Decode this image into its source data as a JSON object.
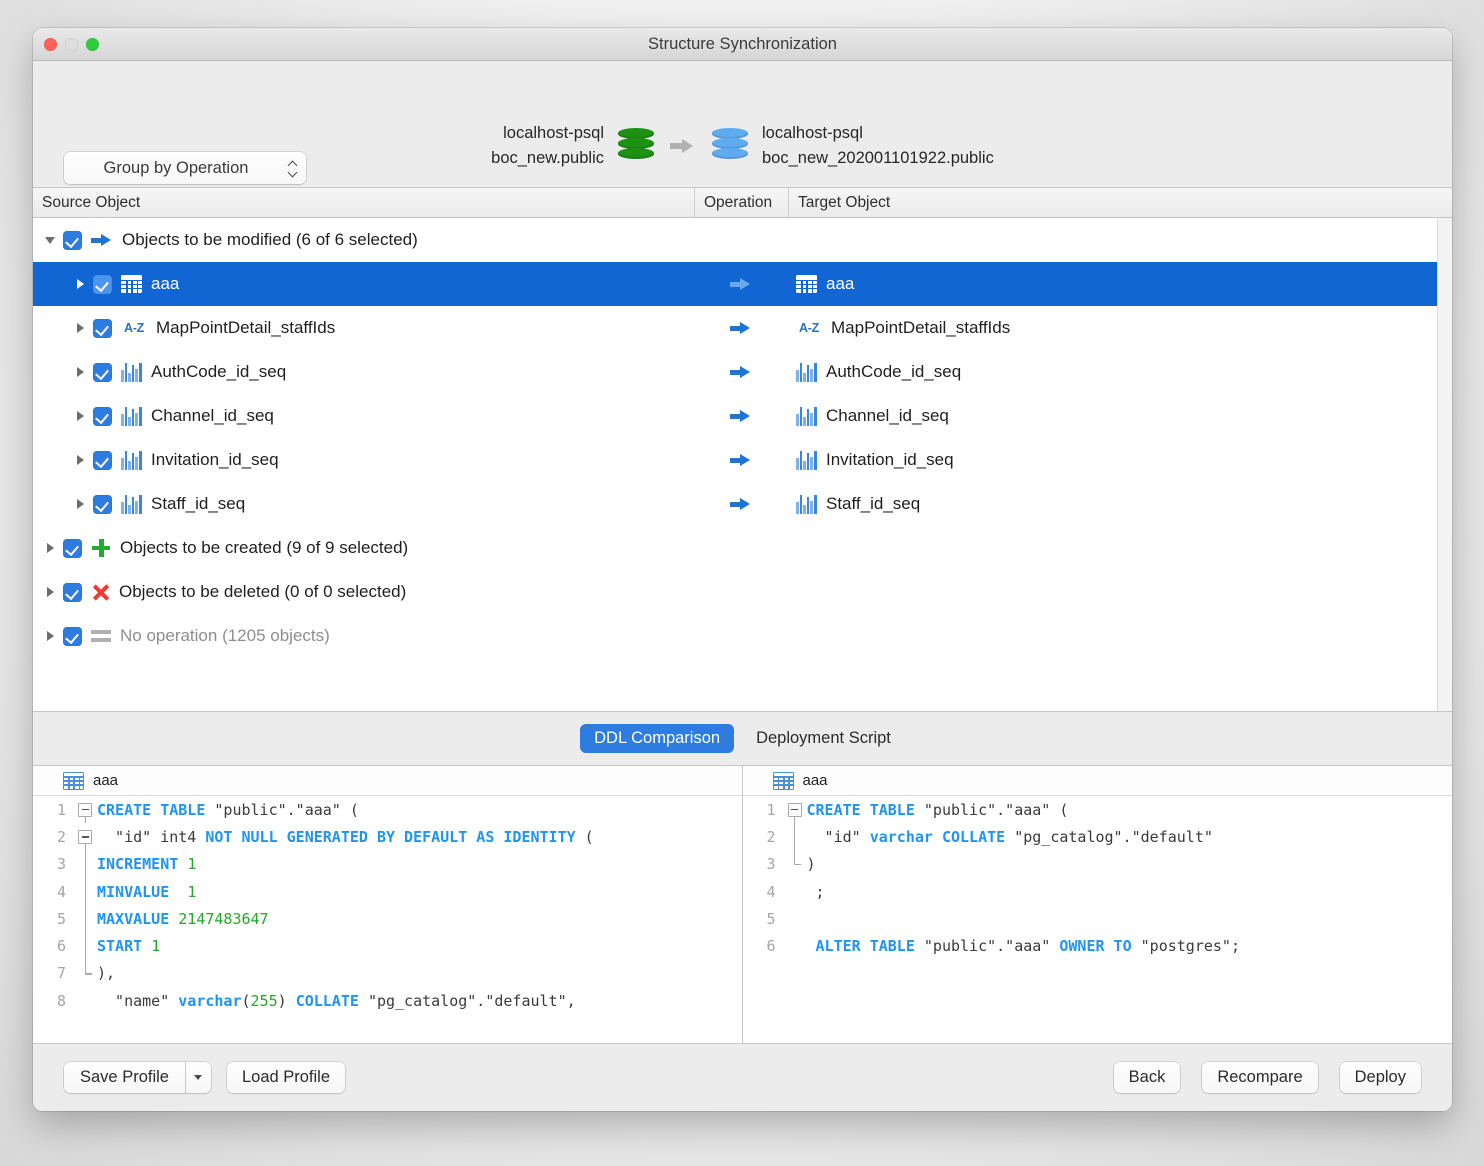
{
  "window": {
    "title": "Structure Synchronization",
    "traffic_lights": [
      "close-red",
      "minimize-gray",
      "maximize-green"
    ]
  },
  "toolbar": {
    "group_select_label": "Group by Operation",
    "source_db": {
      "connection": "localhost-psql",
      "schema": "boc_new.public",
      "icon": "database-icon-green",
      "color": "#1c9113"
    },
    "target_db": {
      "connection": "localhost-psql",
      "schema": "boc_new_202001101922.public",
      "icon": "database-icon-blue",
      "color": "#5fabf2"
    },
    "direction_icon": "right-arrow-icon"
  },
  "columns": {
    "source": "Source Object",
    "operation": "Operation",
    "target": "Target Object"
  },
  "tree": [
    {
      "label": "Objects to be modified (6 of 6 selected)",
      "level": 0,
      "expanded": true,
      "checked": true,
      "glyph": "arrow-right-blue-icon",
      "muted": false,
      "operation": "",
      "target": "",
      "target_icon": ""
    },
    {
      "label": "aaa",
      "level": 1,
      "expanded": false,
      "checked": true,
      "icon": "table-icon",
      "selected": true,
      "operation": "arrow-right-blue-icon",
      "target": "aaa",
      "target_icon": "table-icon"
    },
    {
      "label": "MapPointDetail_staffIds",
      "level": 1,
      "expanded": false,
      "checked": true,
      "icon": "az-index-icon",
      "selected": false,
      "operation": "arrow-right-blue-icon",
      "target": "MapPointDetail_staffIds",
      "target_icon": "az-index-icon"
    },
    {
      "label": "AuthCode_id_seq",
      "level": 1,
      "expanded": false,
      "checked": true,
      "icon": "sequence-icon",
      "selected": false,
      "operation": "arrow-right-blue-icon",
      "target": "AuthCode_id_seq",
      "target_icon": "sequence-icon"
    },
    {
      "label": "Channel_id_seq",
      "level": 1,
      "expanded": false,
      "checked": true,
      "icon": "sequence-icon",
      "selected": false,
      "operation": "arrow-right-blue-icon",
      "target": "Channel_id_seq",
      "target_icon": "sequence-icon"
    },
    {
      "label": "Invitation_id_seq",
      "level": 1,
      "expanded": false,
      "checked": true,
      "icon": "sequence-icon",
      "selected": false,
      "operation": "arrow-right-blue-icon",
      "target": "Invitation_id_seq",
      "target_icon": "sequence-icon"
    },
    {
      "label": "Staff_id_seq",
      "level": 1,
      "expanded": false,
      "checked": true,
      "icon": "sequence-icon",
      "selected": false,
      "operation": "arrow-right-blue-icon",
      "target": "Staff_id_seq",
      "target_icon": "sequence-icon"
    },
    {
      "label": "Objects to be created (9 of 9 selected)",
      "level": 0,
      "expanded": false,
      "checked": true,
      "glyph": "plus-green-icon",
      "muted": false,
      "operation": "",
      "target": "",
      "target_icon": ""
    },
    {
      "label": "Objects to be deleted (0 of 0 selected)",
      "level": 0,
      "expanded": false,
      "checked": true,
      "glyph": "x-red-icon",
      "muted": false,
      "operation": "",
      "target": "",
      "target_icon": ""
    },
    {
      "label": "No operation (1205 objects)",
      "level": 0,
      "expanded": false,
      "checked": true,
      "glyph": "equals-gray-icon",
      "muted": true,
      "operation": "",
      "target": "",
      "target_icon": ""
    }
  ],
  "tabs": [
    {
      "label": "DDL Comparison",
      "active": true
    },
    {
      "label": "Deployment Script",
      "active": false
    }
  ],
  "ddl": {
    "left": {
      "header_title": "aaa",
      "header_icon": "table-icon",
      "lines": [
        {
          "n": "1",
          "fold": "box-top",
          "tokens": [
            {
              "t": "kw",
              "v": "CREATE TABLE "
            },
            {
              "t": "pln",
              "v": "\"public\".\"aaa\" ("
            }
          ]
        },
        {
          "n": "2",
          "fold": "box-mid",
          "tokens": [
            {
              "t": "pln",
              "v": "  \"id\" int4 "
            },
            {
              "t": "kw",
              "v": "NOT NULL GENERATED BY DEFAULT AS IDENTITY "
            },
            {
              "t": "pln",
              "v": "("
            }
          ]
        },
        {
          "n": "3",
          "fold": "line",
          "tokens": [
            {
              "t": "kw",
              "v": "INCREMENT "
            },
            {
              "t": "num",
              "v": "1"
            }
          ]
        },
        {
          "n": "4",
          "fold": "line",
          "tokens": [
            {
              "t": "kw",
              "v": "MINVALUE  "
            },
            {
              "t": "num",
              "v": "1"
            }
          ]
        },
        {
          "n": "5",
          "fold": "line",
          "tokens": [
            {
              "t": "kw",
              "v": "MAXVALUE "
            },
            {
              "t": "num",
              "v": "2147483647"
            }
          ]
        },
        {
          "n": "6",
          "fold": "line",
          "tokens": [
            {
              "t": "kw",
              "v": "START "
            },
            {
              "t": "num",
              "v": "1"
            }
          ]
        },
        {
          "n": "7",
          "fold": "end",
          "tokens": [
            {
              "t": "pln",
              "v": "),"
            }
          ]
        },
        {
          "n": "8",
          "fold": "none",
          "tokens": [
            {
              "t": "pln",
              "v": "  \"name\" "
            },
            {
              "t": "kw",
              "v": "varchar"
            },
            {
              "t": "pln",
              "v": "("
            },
            {
              "t": "num",
              "v": "255"
            },
            {
              "t": "pln",
              "v": ") "
            },
            {
              "t": "kw",
              "v": "COLLATE "
            },
            {
              "t": "pln",
              "v": "\"pg_catalog\".\"default\","
            }
          ]
        }
      ]
    },
    "right": {
      "header_title": "aaa",
      "header_icon": "table-icon",
      "lines": [
        {
          "n": "1",
          "fold": "box-top",
          "tokens": [
            {
              "t": "kw",
              "v": "CREATE TABLE "
            },
            {
              "t": "pln",
              "v": "\"public\".\"aaa\" ("
            }
          ]
        },
        {
          "n": "2",
          "fold": "line",
          "tokens": [
            {
              "t": "pln",
              "v": "  \"id\" "
            },
            {
              "t": "kw",
              "v": "varchar COLLATE "
            },
            {
              "t": "pln",
              "v": "\"pg_catalog\".\"default\""
            }
          ]
        },
        {
          "n": "3",
          "fold": "end",
          "tokens": [
            {
              "t": "pln",
              "v": ")"
            }
          ]
        },
        {
          "n": "4",
          "fold": "none",
          "tokens": [
            {
              "t": "pln",
              "v": " ;"
            }
          ]
        },
        {
          "n": "5",
          "fold": "none",
          "tokens": [
            {
              "t": "pln",
              "v": ""
            }
          ]
        },
        {
          "n": "6",
          "fold": "none",
          "tokens": [
            {
              "t": "kw",
              "v": " ALTER TABLE "
            },
            {
              "t": "pln",
              "v": "\"public\".\"aaa\" "
            },
            {
              "t": "kw",
              "v": "OWNER TO "
            },
            {
              "t": "pln",
              "v": "\"postgres\";"
            }
          ]
        }
      ]
    }
  },
  "footer": {
    "save_profile": "Save Profile",
    "save_profile_menu_icon": "chevron-down-icon",
    "load_profile": "Load Profile",
    "back": "Back",
    "recompare": "Recompare",
    "deploy": "Deploy"
  },
  "colors": {
    "accent": "#2f7ce0",
    "selection": "#1266d4",
    "keyword": "#2094f3",
    "number": "#22a828",
    "green_db": "#1c9113",
    "blue_db": "#5fabf2",
    "plus": "#22aa33",
    "delete": "#ee3a2f"
  }
}
